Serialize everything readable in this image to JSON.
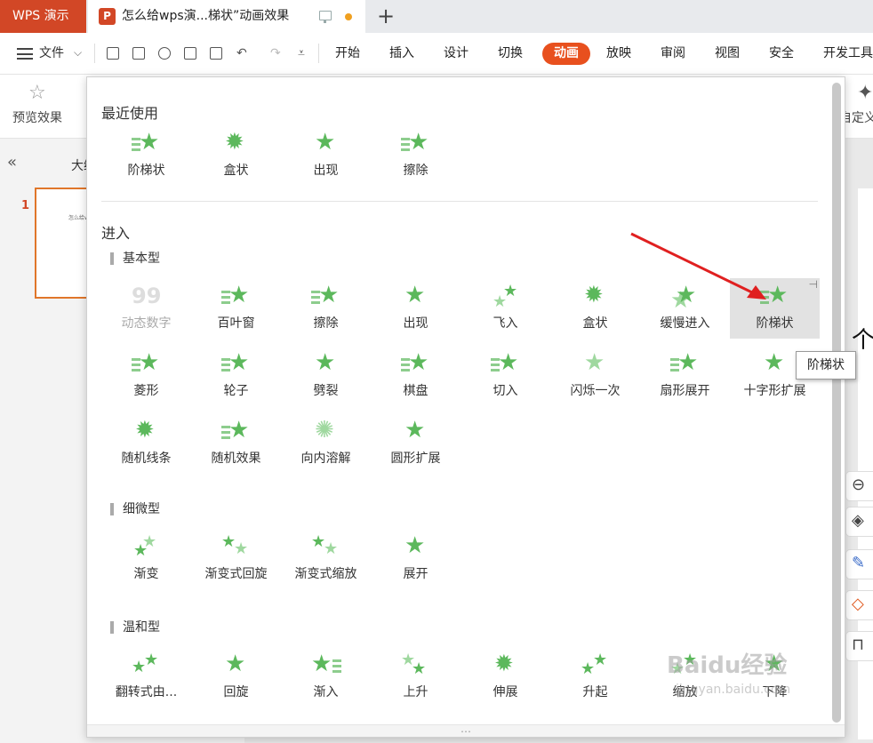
{
  "app": {
    "brand": "WPS 演示",
    "doc_title": "怎么给wps演...梯状”动画效果",
    "doc_icon": "P"
  },
  "menubar": {
    "file": "文件",
    "items": [
      "开始",
      "插入",
      "设计",
      "切换",
      "动画",
      "放映",
      "审阅",
      "视图",
      "安全",
      "开发工具"
    ],
    "active": "动画"
  },
  "ribbon": {
    "preview": "预览效果",
    "custom": "自定义"
  },
  "leftpanel": {
    "outline": "大纲",
    "slide_number": "1",
    "thumb_text": "怎么给wps演示"
  },
  "canvas": {
    "glyph": "个"
  },
  "dropdown": {
    "recent_title": "最近使用",
    "recent": [
      "阶梯状",
      "盒状",
      "出现",
      "擦除"
    ],
    "enter_title": "进入",
    "basic_title": "基本型",
    "basic": [
      "动态数字",
      "百叶窗",
      "擦除",
      "出现",
      "飞入",
      "盒状",
      "缓慢进入",
      "阶梯状",
      "菱形",
      "轮子",
      "劈裂",
      "棋盘",
      "切入",
      "闪烁一次",
      "扇形展开",
      "十字形扩展",
      "随机线条",
      "随机效果",
      "向内溶解",
      "圆形扩展"
    ],
    "subtle_title": "细微型",
    "subtle": [
      "渐变",
      "渐变式回旋",
      "渐变式缩放",
      "展开"
    ],
    "moderate_title": "温和型",
    "moderate": [
      "翻转式由...",
      "回旋",
      "渐入",
      "上升",
      "伸展",
      "升起",
      "缩放",
      "下降"
    ],
    "bottom_handle": "…"
  },
  "tooltip": "阶梯状",
  "watermark": {
    "main": "Baidu经验",
    "sub": "jingyan.baidu.com"
  },
  "colors": {
    "brand": "#d24726",
    "active_tab": "#e8501e",
    "star": "#5cb85c"
  }
}
